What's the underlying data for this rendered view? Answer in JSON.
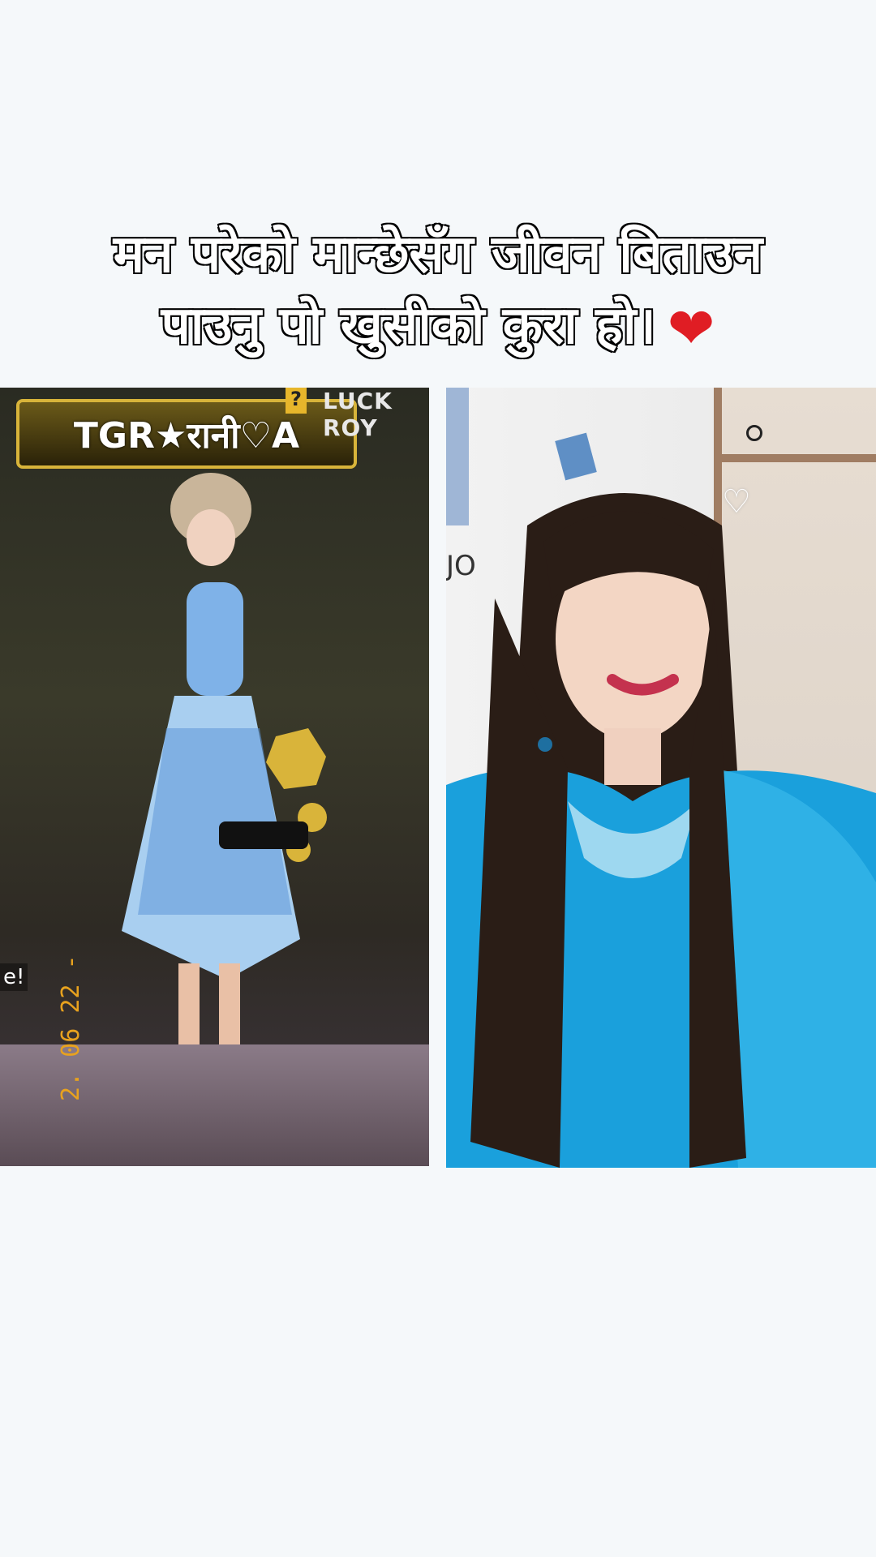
{
  "caption": {
    "line1": "मन परेको मान्छेसँग जीवन बिताउन",
    "line2": "पाउनु पो खुसीको कुरा हो।",
    "heart": "❤"
  },
  "left_panel": {
    "nameplate": "TGR★रानी♡A",
    "corner_text": "LUCK ROY",
    "question_mark": "?",
    "side_tag": "e!",
    "date_stamp": "2. 06 22 -"
  },
  "right_panel": {
    "poster_text": "JO",
    "heart": "♡"
  },
  "colors": {
    "background": "#f5f8fa",
    "heart_red": "#e01d24",
    "dress_blue": "#1aa0dc"
  }
}
